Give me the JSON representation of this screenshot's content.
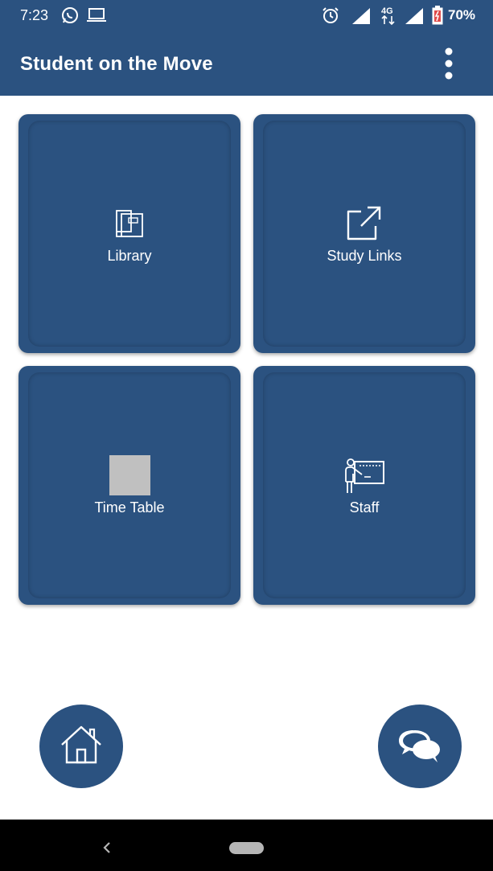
{
  "status_bar": {
    "time": "7:23",
    "battery": "70%",
    "icons": [
      "whatsapp-icon",
      "laptop-icon",
      "alarm-icon",
      "signal-icon",
      "4g-icon",
      "signal-icon",
      "battery-icon"
    ]
  },
  "app_bar": {
    "title": "Student on the Move",
    "menu_icon": "more-vert-icon"
  },
  "tiles": [
    {
      "label": "Library",
      "icon": "books-icon"
    },
    {
      "label": "Study Links",
      "icon": "external-link-icon"
    },
    {
      "label": "Time Table",
      "icon": "image-placeholder"
    },
    {
      "label": "Staff",
      "icon": "teacher-board-icon"
    }
  ],
  "fabs": {
    "home_icon": "home-icon",
    "chat_icon": "chat-bubbles-icon"
  },
  "colors": {
    "primary": "#2b5280",
    "background": "#ffffff",
    "nav_bar": "#000000"
  }
}
